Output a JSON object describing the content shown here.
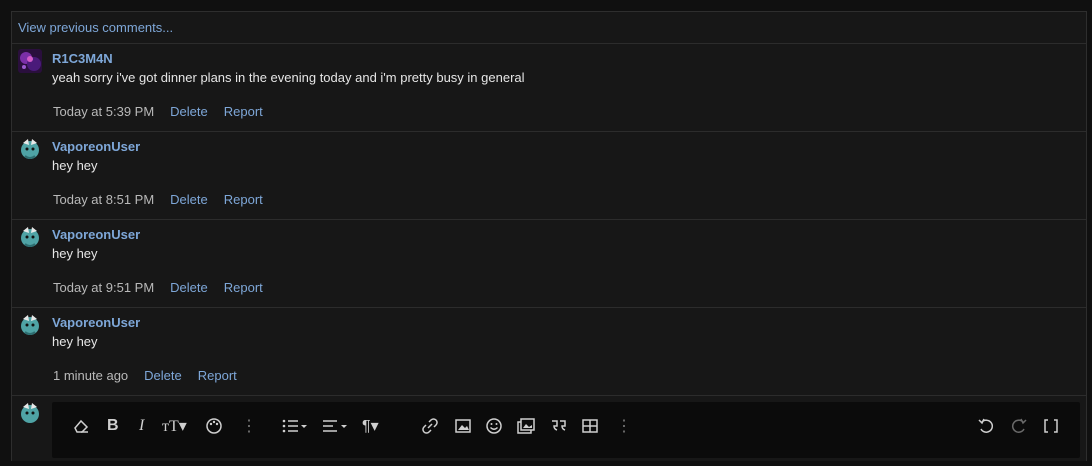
{
  "thread": {
    "view_previous": "View previous comments..."
  },
  "comments": [
    {
      "author": "R1C3M4N",
      "text": "yeah sorry i've got dinner plans in the evening today and i'm pretty busy in general",
      "time": "Today at 5:39 PM",
      "delete_label": "Delete",
      "report_label": "Report",
      "avatar_icon": "galaxy-avatar"
    },
    {
      "author": "VaporeonUser",
      "text": "hey hey",
      "time": "Today at 8:51 PM",
      "delete_label": "Delete",
      "report_label": "Report",
      "avatar_icon": "vaporeon-avatar"
    },
    {
      "author": "VaporeonUser",
      "text": "hey hey",
      "time": "Today at 9:51 PM",
      "delete_label": "Delete",
      "report_label": "Report",
      "avatar_icon": "vaporeon-avatar"
    },
    {
      "author": "VaporeonUser",
      "text": "hey hey",
      "time": "1 minute ago",
      "delete_label": "Delete",
      "report_label": "Report",
      "avatar_icon": "vaporeon-avatar"
    }
  ],
  "editor": {
    "toolbar_icons": [
      "eraser-icon",
      "bold-icon",
      "italic-icon",
      "text-size-icon",
      "palette-icon",
      "more-icon",
      "list-icon",
      "align-icon",
      "paragraph-icon",
      "link-icon",
      "image-icon",
      "emoji-icon",
      "media-icon",
      "quote-icon",
      "table-icon",
      "more-icon",
      "undo-icon",
      "redo-icon",
      "fullscreen-icon"
    ]
  },
  "colors": {
    "link": "#7ea7d8",
    "background": "#171717"
  }
}
